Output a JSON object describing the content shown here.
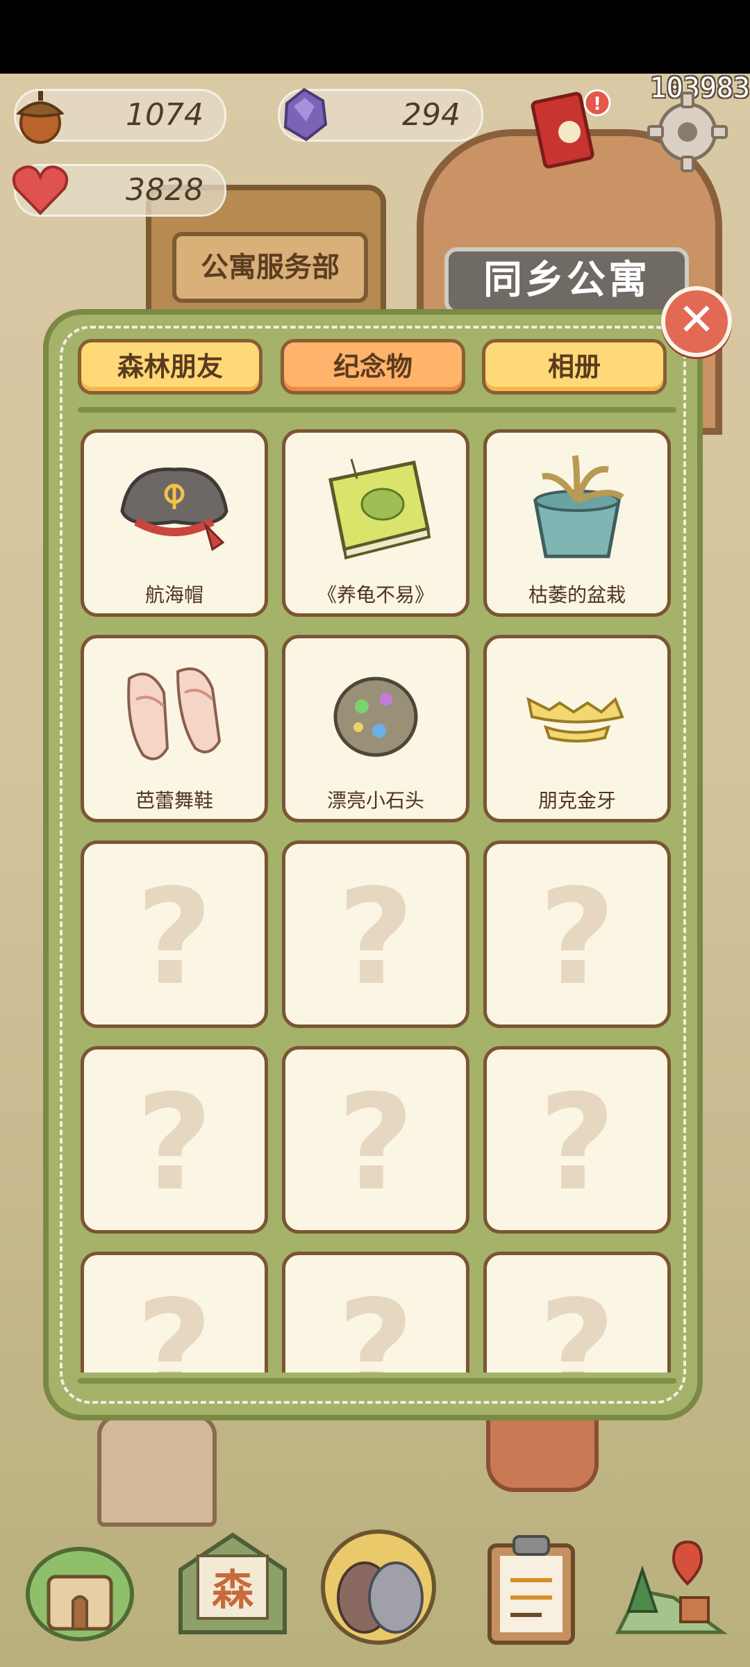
{
  "resources": {
    "acorn": "1074",
    "gem": "294",
    "heart": "3828",
    "counter": "103983"
  },
  "scene": {
    "left_sign": "公寓服务部",
    "right_sign": "同乡公寓"
  },
  "tabs": [
    {
      "label": "森林朋友"
    },
    {
      "label": "纪念物"
    },
    {
      "label": "相册"
    }
  ],
  "items": [
    {
      "name": "航海帽",
      "icon": "pirate-hat-icon"
    },
    {
      "name": "《养龟不易》",
      "icon": "turtle-book-icon"
    },
    {
      "name": "枯萎的盆栽",
      "icon": "withered-plant-icon"
    },
    {
      "name": "芭蕾舞鞋",
      "icon": "ballet-shoes-icon"
    },
    {
      "name": "漂亮小石头",
      "icon": "pretty-stone-icon"
    },
    {
      "name": "朋克金牙",
      "icon": "gold-teeth-icon"
    }
  ],
  "locked_symbol": "?",
  "close_symbol": "✕",
  "bottom_nav": [
    {
      "icon": "house-icon"
    },
    {
      "icon": "mail-icon",
      "label": "森"
    },
    {
      "icon": "birds-icon"
    },
    {
      "icon": "clipboard-icon"
    },
    {
      "icon": "map-icon"
    }
  ],
  "colors": {
    "panel": "#a4b26a",
    "tab": "#ffd978",
    "tab_active": "#ffb36b",
    "cell": "#fbf5e4",
    "close": "#e26a55"
  }
}
